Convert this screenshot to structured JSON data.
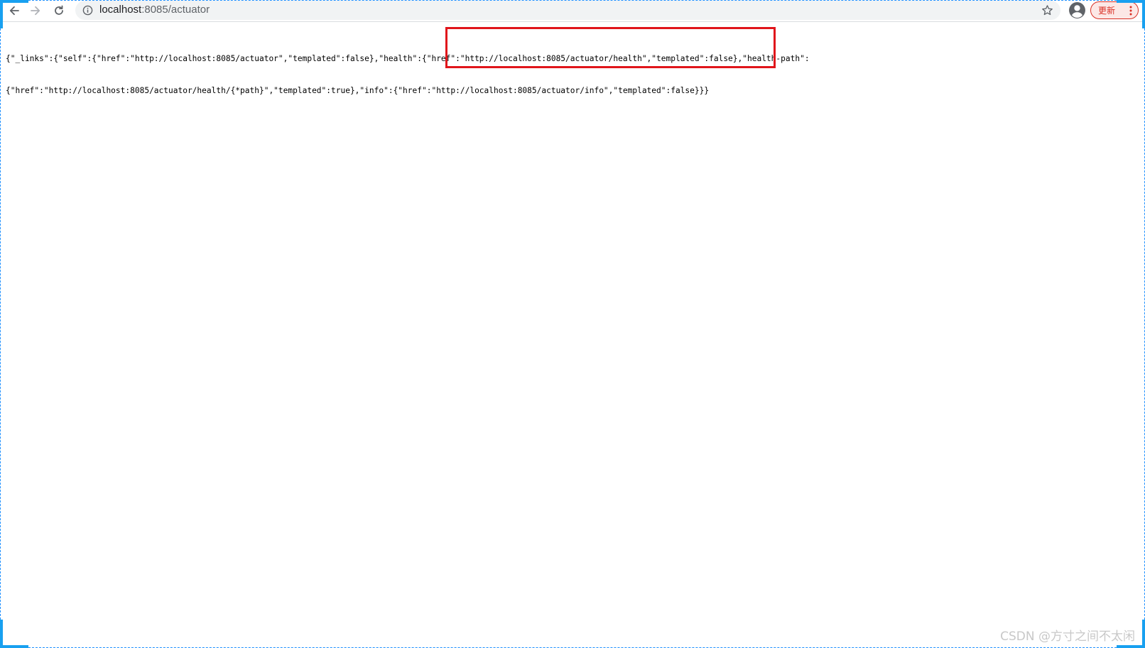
{
  "browser": {
    "url_host": "localhost",
    "url_rest": ":8085/actuator",
    "update_label": "更新"
  },
  "page": {
    "json_line_1": "{\"_links\":{\"self\":{\"href\":\"http://localhost:8085/actuator\",\"templated\":false},\"health\":{\"href\":\"http://localhost:8085/actuator/health\",\"templated\":false},\"health-path\":",
    "json_line_2": "{\"href\":\"http://localhost:8085/actuator/health/{*path}\",\"templated\":true},\"info\":{\"href\":\"http://localhost:8085/actuator/info\",\"templated\":false}}}"
  },
  "annotation": {
    "highlight_color": "#e0151b"
  },
  "watermark": {
    "text": "CSDN @方寸之间不太闲"
  },
  "icons": {
    "back": "back-arrow-icon",
    "forward": "forward-arrow-icon",
    "reload": "reload-icon",
    "info": "info-icon",
    "star": "star-icon",
    "profile": "profile-icon",
    "menu": "menu-dots-icon"
  },
  "colors": {
    "frame": "#18a0f0",
    "update_accent": "#d93025"
  }
}
